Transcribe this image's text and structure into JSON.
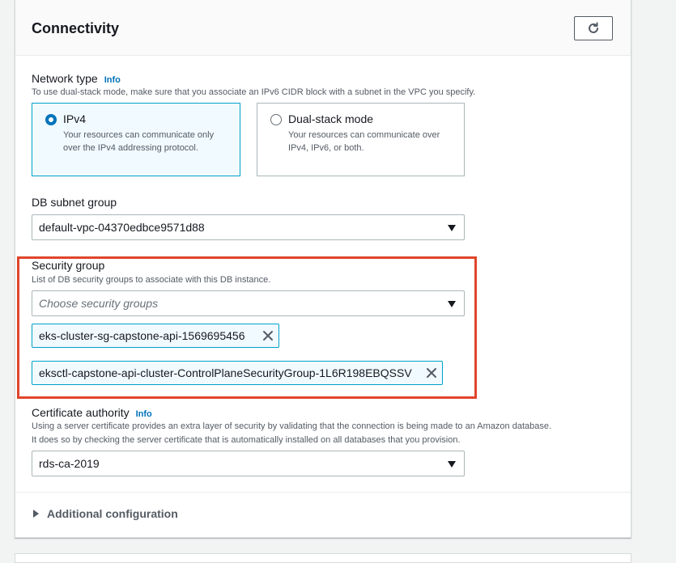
{
  "section": {
    "title": "Connectivity"
  },
  "network_type": {
    "label": "Network type",
    "info": "Info",
    "description": "To use dual-stack mode, make sure that you associate an IPv6 CIDR block with a subnet in the VPC you specify.",
    "options": [
      {
        "title": "IPv4",
        "description": "Your resources can communicate only over the IPv4 addressing protocol.",
        "selected": true
      },
      {
        "title": "Dual-stack mode",
        "description": "Your resources can communicate over IPv4, IPv6, or both.",
        "selected": false
      }
    ]
  },
  "db_subnet_group": {
    "label": "DB subnet group",
    "value": "default-vpc-04370edbce9571d88"
  },
  "security_group": {
    "label": "Security group",
    "description": "List of DB security groups to associate with this DB instance.",
    "placeholder": "Choose security groups",
    "tokens": [
      "eks-cluster-sg-capstone-api-1569695456",
      "eksctl-capstone-api-cluster-ControlPlaneSecurityGroup-1L6R198EBQSSV"
    ]
  },
  "certificate_authority": {
    "label": "Certificate authority",
    "info": "Info",
    "description_line1": "Using a server certificate provides an extra layer of security by validating that the connection is being made to an Amazon database.",
    "description_line2": "It does so by checking the server certificate that is automatically installed on all databases that you provision.",
    "value": "rds-ca-2019"
  },
  "additional_configuration": {
    "label": "Additional configuration"
  },
  "colors": {
    "link": "#0073bb",
    "selected_border": "#00a1c9",
    "highlight": "#e0452b"
  }
}
